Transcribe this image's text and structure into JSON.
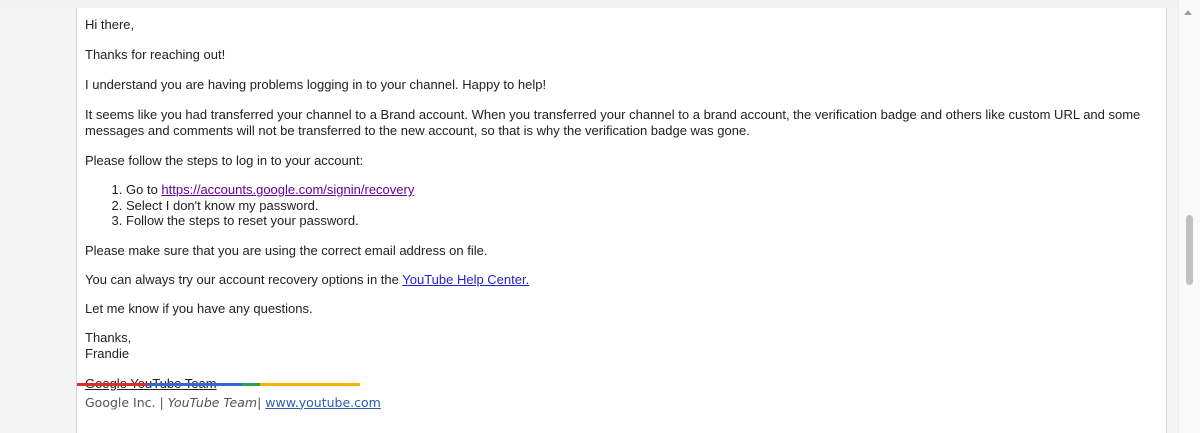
{
  "email": {
    "greeting": "Hi there,",
    "thanks_line": "Thanks for reaching out!",
    "understand_line": "I understand you are having problems logging in to your channel. Happy to help!",
    "explanation": "It seems like you had transferred your channel to a Brand account. When you transferred your channel to a brand account, the verification badge and others like custom URL and some messages and comments will not be transferred to the new account, so that is why the verification badge was gone.",
    "steps_intro": "Please follow the steps to log in to your account:",
    "steps": {
      "step1_prefix": "Go to ",
      "step1_link": "https://accounts.google.com/signin/recovery",
      "step2": "Select I don't know my password.",
      "step3": "Follow the steps to reset your password."
    },
    "email_check": "Please make sure that you are using the correct email address on file.",
    "recovery_prefix": "You can always try our account recovery options in the ",
    "help_center_link": "YouTube Help Center.",
    "questions": "Let me know if you have any questions.",
    "signoff": "Thanks,",
    "agent_name": "Frandie"
  },
  "signature": {
    "team_name": "Google YouTube Team",
    "company": "Google Inc.",
    "separator1": "|",
    "team_italic": "YouTube Team",
    "separator2": "|",
    "website": "www.youtube.com",
    "brand_colors": [
      "#d93025",
      "#3367d6",
      "#2e9e4f",
      "#f6b400"
    ]
  },
  "icons": {
    "scroll_up": "scroll-up-arrow-icon"
  }
}
